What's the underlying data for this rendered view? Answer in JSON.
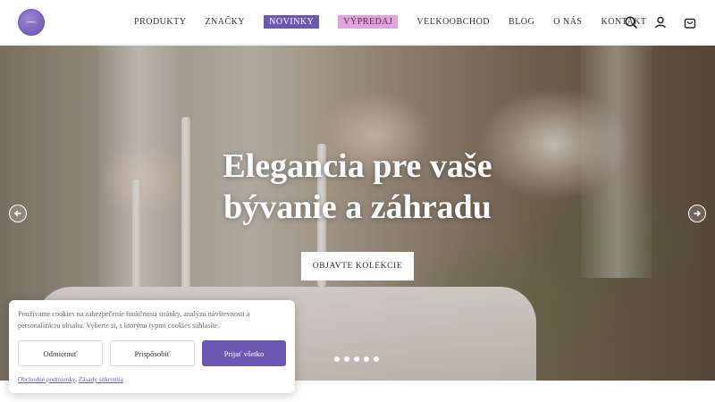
{
  "header": {
    "logo_icon": "brand-logo-circle",
    "accent_color": "#6b58b3",
    "sale_color": "#e2a2db",
    "nav": [
      {
        "label": "PRODUKTY"
      },
      {
        "label": "ZNAČKY"
      },
      {
        "label": "NOVINKY"
      },
      {
        "label": "VÝPREDAJ"
      },
      {
        "label": "VEĽKOOBCHOD"
      },
      {
        "label": "BLOG"
      },
      {
        "label": "O NÁS"
      },
      {
        "label": "KONTAKT"
      }
    ],
    "icons": [
      "search-icon",
      "user-icon",
      "cart-icon"
    ]
  },
  "hero": {
    "title_line1": "Elegancia pre vaše",
    "title_line2": "bývanie a záhradu",
    "cta_label": "OBJAVTE KOLEKCIE",
    "slide_count": 5,
    "active_slide": 1
  },
  "cookie_banner": {
    "text": "Používame cookies na zabezpečenie funkčnosti stránky, analýzu návštevnosti a personalizáciu obsahu. Vyberte si, s ktorými typmi cookies súhlasíte.",
    "reject_label": "Odmietnuť",
    "customize_label": "Prispôsobiť",
    "accept_label": "Prijať všetko",
    "link_terms": "Obchodné podmienky",
    "link_separator": ",",
    "link_privacy": "Zásady súkromia"
  }
}
